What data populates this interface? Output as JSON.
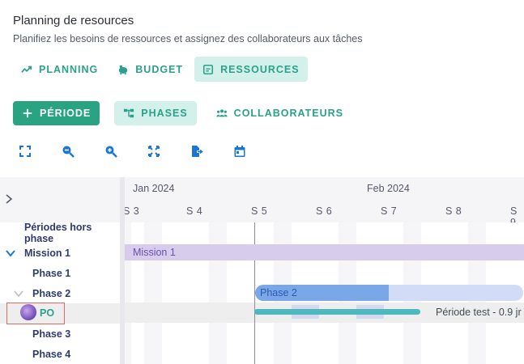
{
  "header": {
    "title": "Planning de resources",
    "subtitle": "Planifiez les besoins de ressources et assignez des collaborateurs aux tâches"
  },
  "tabs": [
    {
      "label": "PLANNING",
      "icon": "trend-icon",
      "active": false
    },
    {
      "label": "BUDGET",
      "icon": "piggy-bank-icon",
      "active": false
    },
    {
      "label": "RESSOURCES",
      "icon": "calendar-list-icon",
      "active": true
    }
  ],
  "actions": {
    "add_period": "PÉRIODE",
    "phases": "PHASES",
    "collaborators": "COLLABORATEURS"
  },
  "toolbar": [
    "fullscreen-icon",
    "zoom-out-icon",
    "zoom-in-icon",
    "fit-icon",
    "export-icon",
    "calendar-icon"
  ],
  "colors": {
    "accent": "#2aa383",
    "accent_soft": "#d3f1ea",
    "mission": "#d7ccec",
    "phase": "#7aa7e8",
    "period": "#4cb8c0",
    "row_text": "#2d3b6e"
  },
  "timeline": {
    "months": [
      "Jan 2024",
      "Feb 2024"
    ],
    "weeks": [
      "S 3",
      "S 4",
      "S 5",
      "S 6",
      "S 7",
      "S 8",
      "S 9"
    ]
  },
  "rows": [
    {
      "label": "Périodes hors phase"
    },
    {
      "label": "Mission 1"
    },
    {
      "label": "Phase 1"
    },
    {
      "label": "Phase 2"
    },
    {
      "label": "PO"
    },
    {
      "label": "Phase 3"
    },
    {
      "label": "Phase 4"
    }
  ],
  "bars": {
    "mission": "Mission 1",
    "phase": "Phase 2",
    "period": "Période test - 0.9 jr"
  }
}
